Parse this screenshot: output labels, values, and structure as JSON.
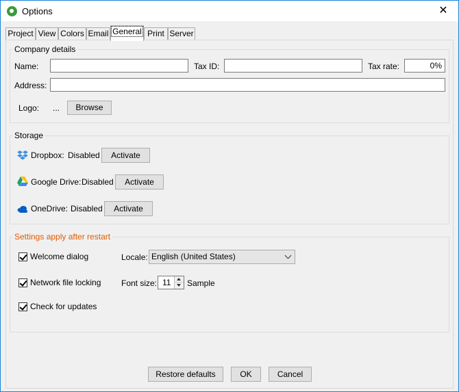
{
  "window": {
    "title": "Options",
    "close_glyph": "✕"
  },
  "tabs": [
    {
      "label": "Project",
      "active": false
    },
    {
      "label": "View",
      "active": false
    },
    {
      "label": "Colors",
      "active": false
    },
    {
      "label": "Email",
      "active": false
    },
    {
      "label": "General",
      "active": true
    },
    {
      "label": "Print",
      "active": false
    },
    {
      "label": "Server",
      "active": false
    }
  ],
  "company": {
    "title": "Company details",
    "name_label": "Name:",
    "name_value": "",
    "taxid_label": "Tax ID:",
    "taxid_value": "",
    "taxrate_label": "Tax rate:",
    "taxrate_value": "0%",
    "address_label": "Address:",
    "address_value": "",
    "logo_label": "Logo:",
    "logo_value": "...",
    "browse_label": "Browse"
  },
  "storage": {
    "title": "Storage",
    "items": [
      {
        "label": "Dropbox:",
        "status": "Disabled",
        "action": "Activate",
        "icon": "dropbox-icon"
      },
      {
        "label": "Google Drive:",
        "status": "Disabled",
        "action": "Activate",
        "icon": "google-drive-icon"
      },
      {
        "label": "OneDrive:",
        "status": "Disabled",
        "action": "Activate",
        "icon": "onedrive-icon"
      }
    ]
  },
  "restart": {
    "title": "Settings apply after restart",
    "title_color": "#e05a00",
    "welcome_label": "Welcome dialog",
    "welcome_checked": true,
    "locking_label": "Network file locking",
    "locking_checked": true,
    "updates_label": "Check for updates",
    "updates_checked": true,
    "locale_label": "Locale:",
    "locale_value": "English (United States)",
    "fontsize_label": "Font size:",
    "fontsize_value": "11",
    "sample_label": "Sample"
  },
  "footer": {
    "restore_label": "Restore defaults",
    "ok_label": "OK",
    "cancel_label": "Cancel"
  }
}
